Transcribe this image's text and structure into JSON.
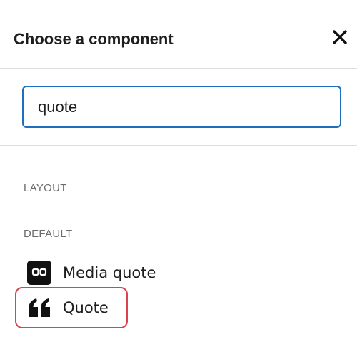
{
  "dialog": {
    "title": "Choose a component",
    "close_icon": "close-icon"
  },
  "search": {
    "value": "quote",
    "placeholder": ""
  },
  "sections": {
    "layout": "LAYOUT",
    "default": "DEFAULT"
  },
  "components": [
    {
      "label": "Media quote",
      "icon": "media-quote-icon"
    },
    {
      "label": "Quote",
      "icon": "quote-icon",
      "highlighted": true
    }
  ],
  "colors": {
    "accent": "#1f6fbf",
    "highlight": "#d9434f",
    "heading_text": "#6b6b6b"
  }
}
